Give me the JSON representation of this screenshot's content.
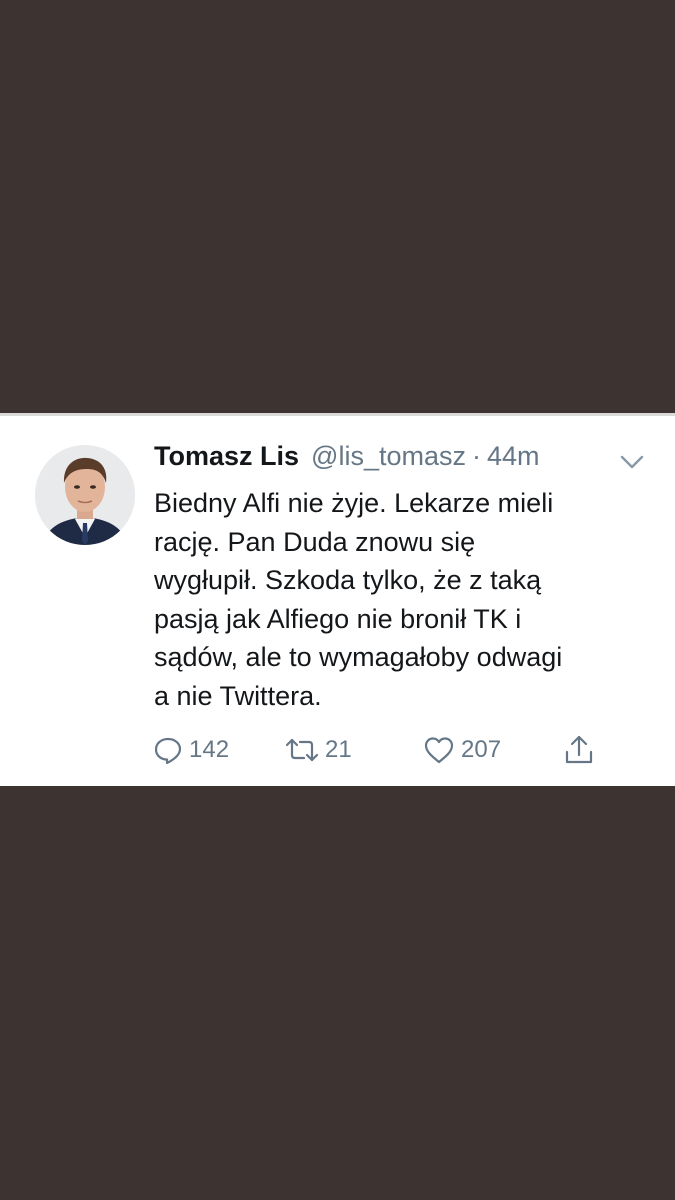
{
  "tweet": {
    "author_name": "Tomasz Lis",
    "author_handle": "@lis_tomasz",
    "separator": "·",
    "timestamp": "44m",
    "text": "Biedny Alfi nie żyje. Lekarze mieli\nrację. Pan Duda znowu się\nwygłupił. Szkoda tylko, że z taką\npasją jak Alfiego nie bronił TK i\nsądów, ale to wymagałoby odwagi\na nie Twittera.",
    "counts": {
      "replies": "142",
      "retweets": "21",
      "likes": "207"
    }
  },
  "icons": {
    "reply": "reply-icon",
    "retweet": "retweet-icon",
    "like": "heart-icon",
    "share": "share-icon",
    "more": "chevron-down-icon"
  },
  "colors": {
    "background": "#3d3330",
    "card": "#ffffff",
    "text": "#14171a",
    "secondary": "#657786"
  }
}
